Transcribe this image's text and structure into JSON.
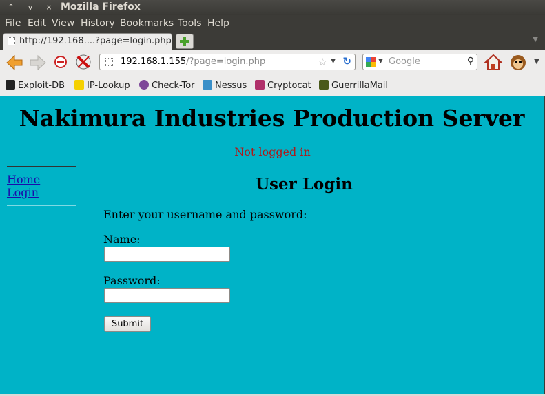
{
  "window": {
    "title": "Mozilla Firefox",
    "controls": [
      "^",
      "v",
      "×"
    ]
  },
  "menu": [
    "File",
    "Edit",
    "View",
    "History",
    "Bookmarks",
    "Tools",
    "Help"
  ],
  "tab": {
    "title": "http://192.168....?page=login.php"
  },
  "urlbar": {
    "host": "192.168.1.155",
    "path": "/?page=login.php"
  },
  "search": {
    "engine": "Google",
    "placeholder": "Google"
  },
  "bookmarks": [
    "Exploit-DB",
    "IP-Lookup",
    "Check-Tor",
    "Nessus",
    "Cryptocat",
    "GuerrillaMail"
  ],
  "page": {
    "site_title": "Nakimura Industries Production Server",
    "status": "Not logged in",
    "nav": [
      "Home",
      "Login"
    ],
    "heading": "User Login",
    "prompt": "Enter your username and password:",
    "name_label": "Name:",
    "name_value": "",
    "password_label": "Password:",
    "password_value": "",
    "submit_label": "Submit"
  },
  "colors": {
    "page_background": "#00b3c7",
    "status_text": "#b01818",
    "link": "#1a0dab",
    "chrome_dark": "#3c3b37",
    "toolbar": "#edeceb"
  }
}
